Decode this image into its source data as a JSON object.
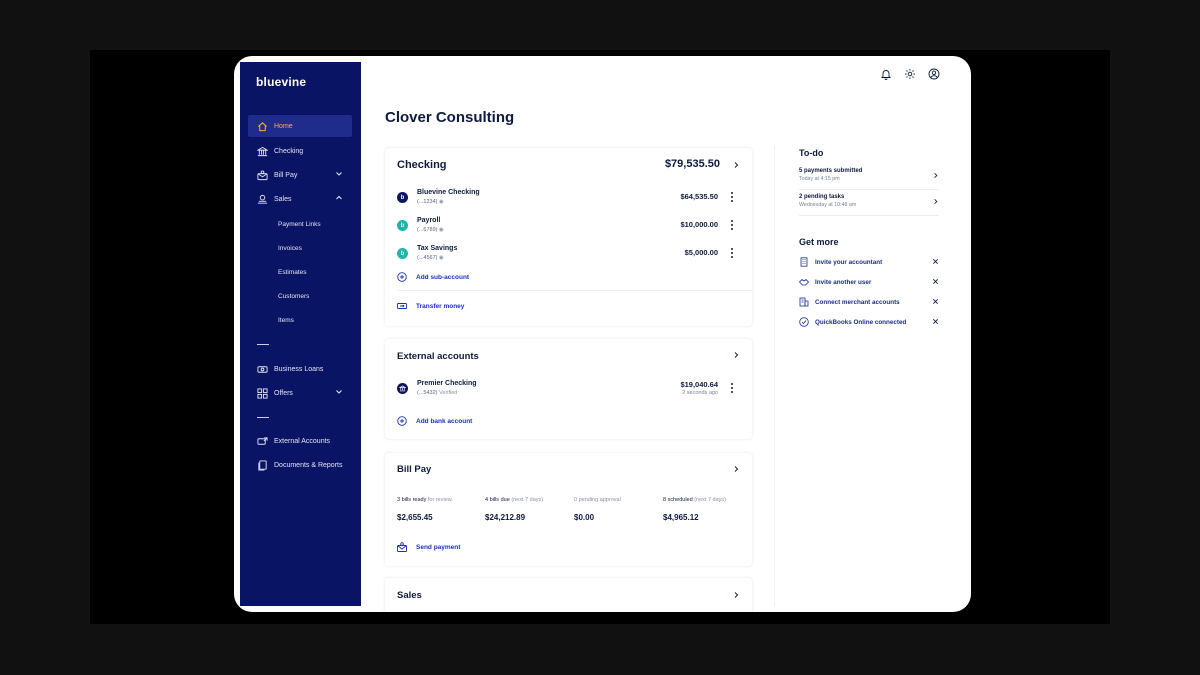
{
  "brand": {
    "logo": "bluevine"
  },
  "sidebar": {
    "items": [
      {
        "label": "Home",
        "icon": "home-icon",
        "active": true
      },
      {
        "label": "Checking",
        "icon": "bank-icon"
      },
      {
        "label": "Bill Pay",
        "icon": "envelope-money-icon",
        "expandable": "down"
      },
      {
        "label": "Sales",
        "icon": "sales-icon",
        "expandable": "up"
      },
      {
        "label": "Business Loans",
        "icon": "loan-icon"
      },
      {
        "label": "Offers",
        "icon": "grid-icon",
        "expandable": "down"
      },
      {
        "label": "External Accounts",
        "icon": "external-accounts-icon"
      },
      {
        "label": "Documents & Reports",
        "icon": "documents-icon"
      }
    ],
    "sales_sub": [
      "Payment Links",
      "Invoices",
      "Estimates",
      "Customers",
      "Items"
    ]
  },
  "header": {
    "icons": [
      "bell-icon",
      "gear-icon",
      "user-icon"
    ]
  },
  "page": {
    "title": "Clover Consulting"
  },
  "checking": {
    "title": "Checking",
    "total": "$79,535.50",
    "accounts": [
      {
        "name": "Bluevine Checking",
        "number": "(...1234)",
        "amount": "$64,535.50",
        "color": "#0a1464",
        "icon_letter": "b"
      },
      {
        "name": "Payroll",
        "number": "(...6789)",
        "amount": "$10,000.00",
        "color": "#1fb5a8",
        "icon_letter": "b"
      },
      {
        "name": "Tax Savings",
        "number": "(...4567)",
        "amount": "$5,000.00",
        "color": "#1fb5a8",
        "icon_letter": "b"
      }
    ],
    "add_sub_account": "Add sub-account",
    "transfer_money": "Transfer money"
  },
  "external": {
    "title": "External accounts",
    "accounts": [
      {
        "name": "Premier Checking",
        "number": "(...5432)",
        "status": "Verified",
        "amount": "$19,040.64",
        "updated": "2 seconds ago"
      }
    ],
    "add_bank": "Add bank account"
  },
  "billpay": {
    "title": "Bill Pay",
    "stats": [
      {
        "label_strong": "3 bills ready",
        "label_muted": "for review",
        "value": "$2,655.45"
      },
      {
        "label_strong": "4 bills due",
        "label_muted": "(next 7 days)",
        "value": "$24,212.89"
      },
      {
        "label_strong": "0 pending approval",
        "label_muted": "",
        "value": "$0.00"
      },
      {
        "label_strong": "8 scheduled",
        "label_muted": "(next 7 days)",
        "value": "$4,965.12"
      }
    ],
    "send_payment": "Send payment"
  },
  "sales": {
    "title": "Sales"
  },
  "todo": {
    "title": "To-do",
    "items": [
      {
        "main": "5 payments submitted",
        "sub": "Today at 4:15 pm"
      },
      {
        "main": "2 pending tasks",
        "sub": "Wednesday at 10:48 am"
      }
    ]
  },
  "getmore": {
    "title": "Get more",
    "items": [
      {
        "label": "Invite your accountant",
        "icon": "building-icon"
      },
      {
        "label": "Invite another user",
        "icon": "handshake-icon"
      },
      {
        "label": "Connect merchant accounts",
        "icon": "store-icon"
      },
      {
        "label": "QuickBooks Online connected",
        "icon": "check-circle-icon"
      }
    ]
  },
  "colors": {
    "sidebar_bg": "#0a1464",
    "active_item": "#f5b52e",
    "link": "#1a2fbf",
    "text": "#0d1b3e"
  }
}
